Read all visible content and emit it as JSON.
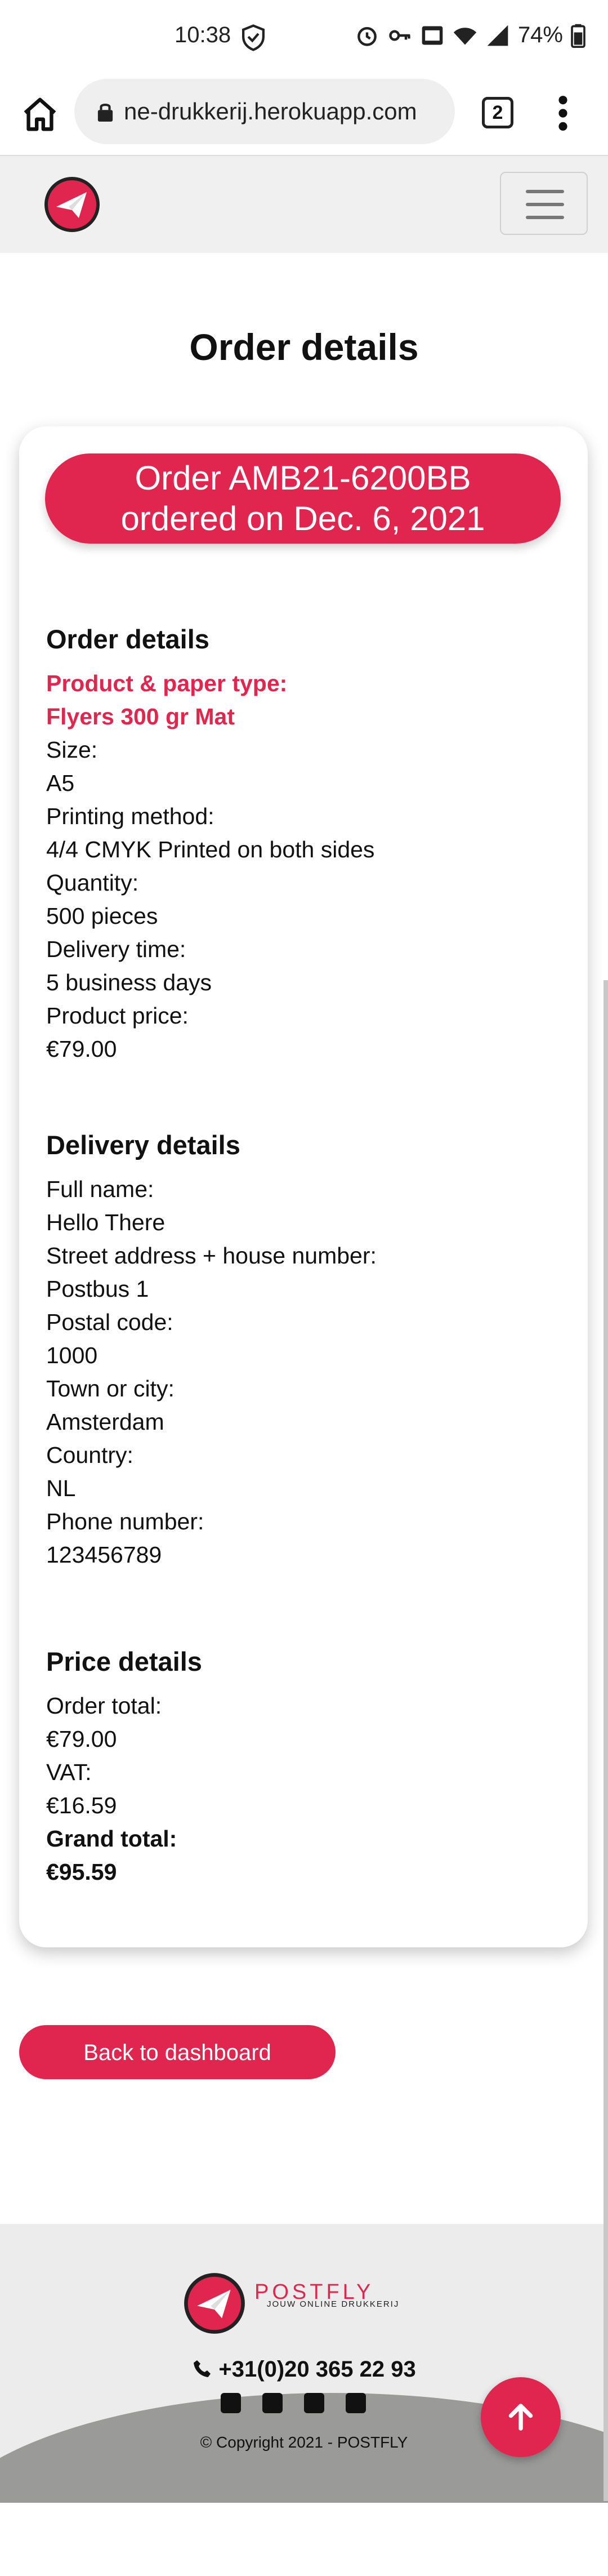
{
  "status_bar": {
    "time": "10:38",
    "battery": "74%"
  },
  "browser": {
    "url": "ne-drukkerij.herokuapp.com",
    "tab_count": "2"
  },
  "page": {
    "title": "Order details"
  },
  "order": {
    "line1": "Order AMB21-6200BB",
    "line2": "ordered on Dec. 6, 2021"
  },
  "order_details": {
    "heading": "Order details",
    "product_label": "Product & paper type:",
    "product_value": "Flyers 300 gr Mat",
    "size_label": "Size:",
    "size_value": "A5",
    "method_label": "Printing method:",
    "method_value": "4/4 CMYK Printed on both sides",
    "quantity_label": "Quantity:",
    "quantity_value": "500 pieces",
    "delivery_time_label": "Delivery time:",
    "delivery_time_value": "5 business days",
    "price_label": "Product price:",
    "price_value": "€79.00"
  },
  "delivery_details": {
    "heading": "Delivery details",
    "name_label": "Full name:",
    "name_value": "Hello There",
    "street_label": "Street address + house number:",
    "street_value": "Postbus 1",
    "postal_label": "Postal code:",
    "postal_value": "1000",
    "city_label": "Town or city:",
    "city_value": "Amsterdam",
    "country_label": "Country:",
    "country_value": "NL",
    "phone_label": "Phone number:",
    "phone_value": "123456789"
  },
  "price_details": {
    "heading": "Price details",
    "order_total_label": "Order total:",
    "order_total_value": "€79.00",
    "vat_label": "VAT:",
    "vat_value": "€16.59",
    "grand_total_label": "Grand total:",
    "grand_total_value": "€95.59"
  },
  "actions": {
    "back_label": "Back to dashboard"
  },
  "footer": {
    "brand": "POSTFLY",
    "tagline": "JOUW ONLINE DRUKKERIJ",
    "phone": "+31(0)20 365 22 93",
    "copyright": "© Copyright 2021 - POSTFLY"
  },
  "colors": {
    "accent": "#e0264e",
    "footer_bg": "#ececec",
    "footer_wave": "#9a9a99"
  },
  "icons": [
    "shield-icon",
    "alarm-icon",
    "key-icon",
    "volte-icon",
    "wifi-icon",
    "signal-icon",
    "battery-icon",
    "home-icon",
    "lock-icon",
    "more-vert-icon",
    "paper-plane-icon",
    "phone-icon",
    "envelope-icon",
    "facebook-icon",
    "instagram-icon",
    "linkedin-icon",
    "arrow-up-icon"
  ]
}
